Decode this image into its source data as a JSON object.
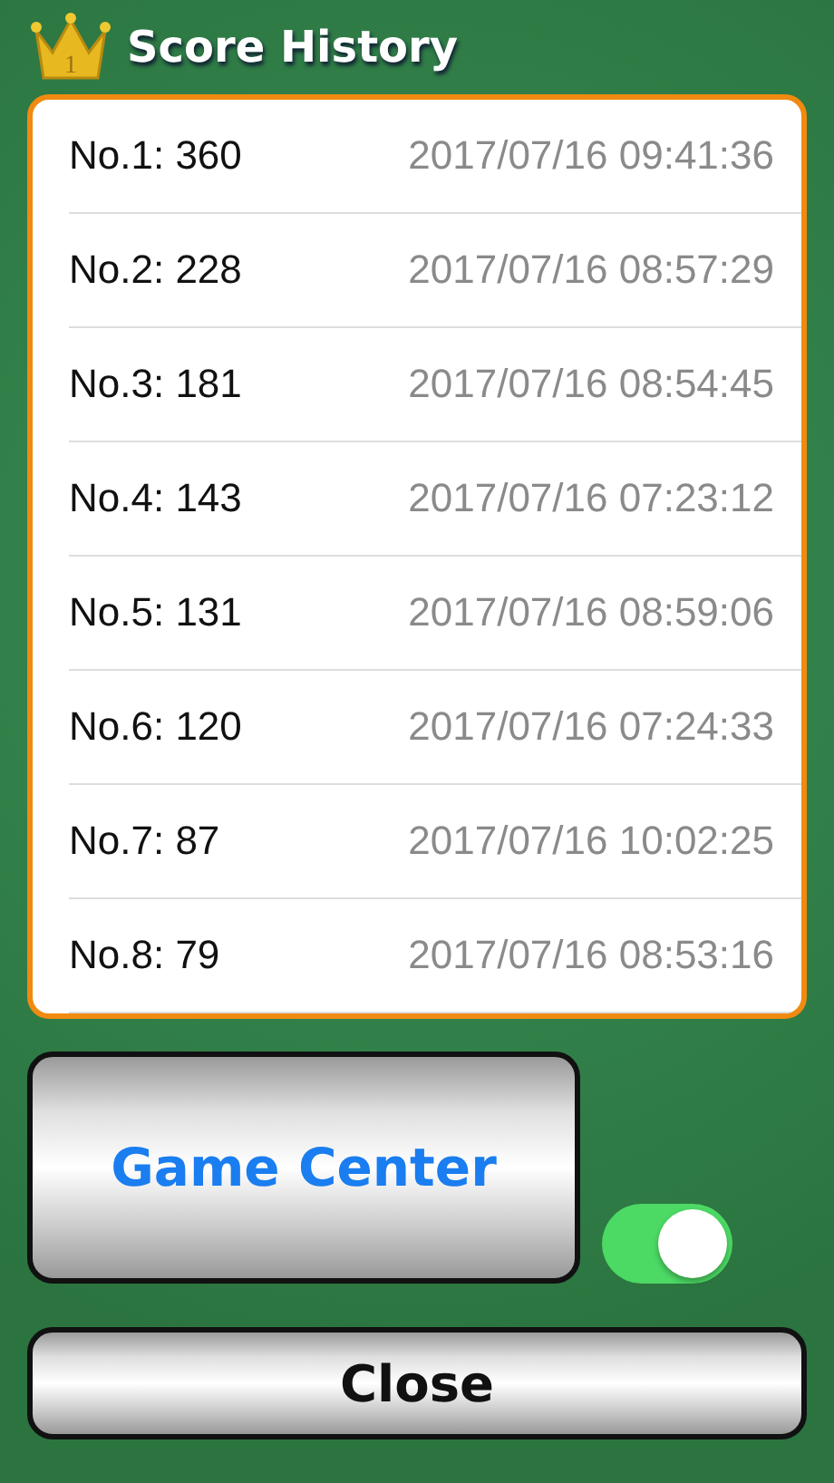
{
  "header": {
    "crown_number": "1",
    "title": "Score History"
  },
  "scores": [
    {
      "rank": "No.1: 360",
      "time": "2017/07/16 09:41:36"
    },
    {
      "rank": "No.2: 228",
      "time": "2017/07/16 08:57:29"
    },
    {
      "rank": "No.3: 181",
      "time": "2017/07/16 08:54:45"
    },
    {
      "rank": "No.4: 143",
      "time": "2017/07/16 07:23:12"
    },
    {
      "rank": "No.5: 131",
      "time": "2017/07/16 08:59:06"
    },
    {
      "rank": "No.6: 120",
      "time": "2017/07/16 07:24:33"
    },
    {
      "rank": "No.7: 87",
      "time": "2017/07/16 10:02:25"
    },
    {
      "rank": "No.8: 79",
      "time": "2017/07/16 08:53:16"
    }
  ],
  "game_center_button": {
    "label": "Game Center"
  },
  "toggle": {
    "on": true
  },
  "close_button": {
    "label": "Close"
  }
}
